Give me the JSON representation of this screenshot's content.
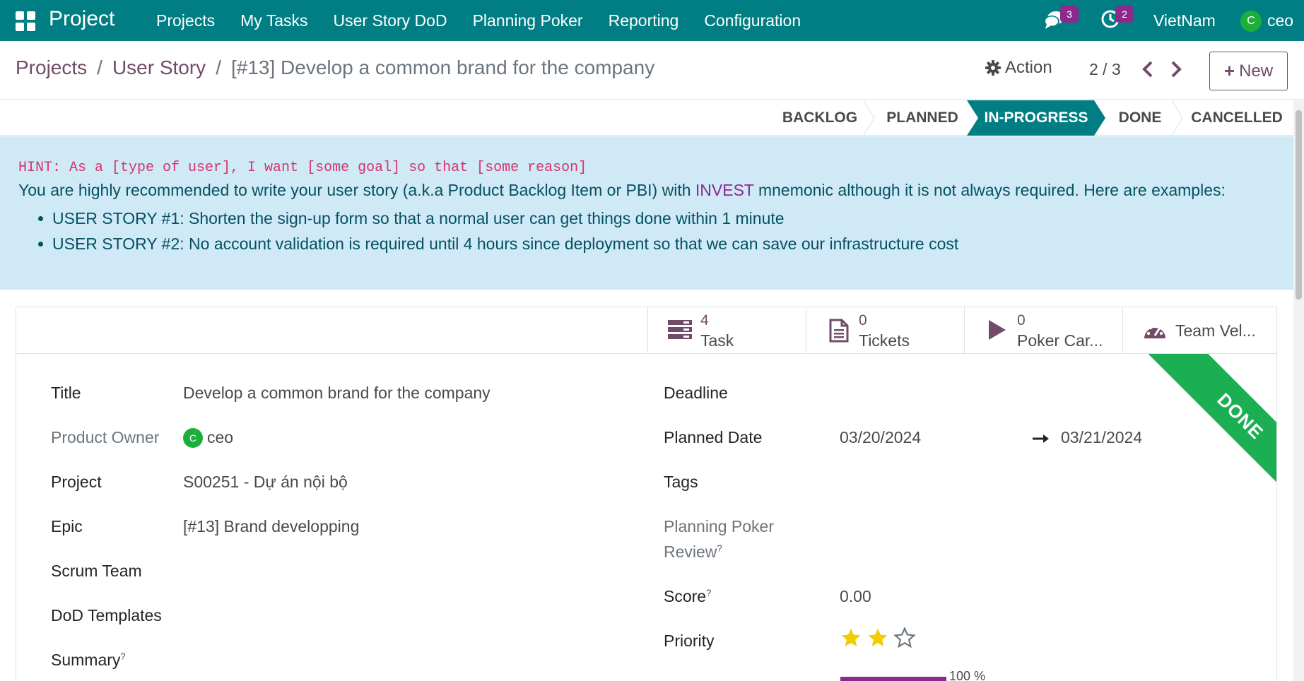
{
  "navbar": {
    "brand": "Project",
    "menu": [
      "Projects",
      "My Tasks",
      "User Story DoD",
      "Planning Poker",
      "Reporting",
      "Configuration"
    ],
    "messages_count": "3",
    "activities_count": "2",
    "company": "VietNam",
    "user_initial": "C",
    "user_name": "ceo"
  },
  "breadcrumb": {
    "root": "Projects",
    "parent": "User Story",
    "current": "[#13] Develop a common brand for the company"
  },
  "control": {
    "action_label": "Action",
    "pager": "2 / 3",
    "new_label": "New"
  },
  "stages": {
    "backlog": "BACKLOG",
    "planned": "PLANNED",
    "in_progress": "IN-PROGRESS",
    "done": "DONE",
    "cancelled": "CANCELLED",
    "active": "IN-PROGRESS"
  },
  "hint": {
    "mono": "HINT: As a [type of user], I want [some goal] so that [some reason]",
    "text_before": "You are highly recommended to write your user story (a.k.a Product Backlog Item or PBI) with ",
    "invest": "INVEST",
    "text_after": " mnemonic although it is not always required. Here are examples:",
    "example_1": "USER STORY #1: Shorten the sign-up form so that a normal user can get things done within 1 minute",
    "example_2": "USER STORY #2: No account validation is required until 4 hours since deployment so that we can save our infrastructure cost"
  },
  "smart_buttons": {
    "task_value": "4",
    "task_label": "Task",
    "tickets_value": "0",
    "tickets_label": "Tickets",
    "poker_value": "0",
    "poker_label": "Poker Car...",
    "velocity_label": "Team Vel..."
  },
  "ribbon": "DONE",
  "fields": {
    "title_label": "Title",
    "title_value": "Develop a common brand for the company",
    "owner_label": "Product Owner",
    "owner_initial": "C",
    "owner_value": "ceo",
    "project_label": "Project",
    "project_value": "S00251 - Dự án nội bộ",
    "epic_label": "Epic",
    "epic_value": "[#13] Brand developping",
    "scrum_team_label": "Scrum Team",
    "dod_label": "DoD Templates",
    "summary_label": "Summary",
    "deadline_label": "Deadline",
    "planned_date_label": "Planned Date",
    "planned_start": "03/20/2024",
    "planned_end": "03/21/2024",
    "tags_label": "Tags",
    "poker_review_label_1": "Planning Poker",
    "poker_review_label_2": "Review",
    "score_label": "Score",
    "score_value": "0.00",
    "priority_label": "Priority",
    "priority_stars": 2,
    "priority_max": 5,
    "progress_percent": 100,
    "progress_text": "100 %",
    "tooltip_mark": "?"
  },
  "colors": {
    "navbar": "#017e84",
    "accent": "#714b67",
    "ribbon": "#1cae53",
    "star": "#f3cc00"
  }
}
